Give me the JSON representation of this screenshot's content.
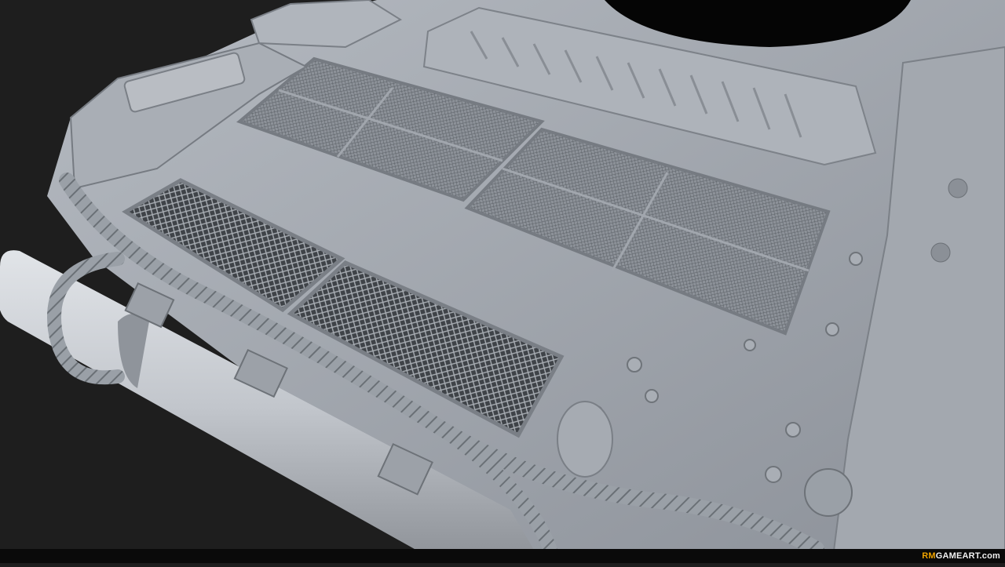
{
  "watermark": {
    "accent_text": "RM",
    "main_text": "GAMEART.com",
    "accent_color": "#f0a400"
  },
  "colors": {
    "background": "#1e1e1e",
    "hull": "#9ea3ab",
    "hull_light": "#c4c8cf",
    "mesh": "#6d7278",
    "log": "#c8ccd2",
    "cable": "#8e939a"
  }
}
